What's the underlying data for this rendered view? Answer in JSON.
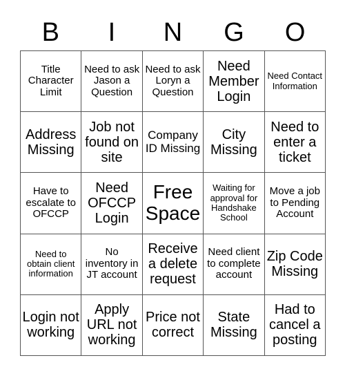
{
  "header": [
    "B",
    "I",
    "N",
    "G",
    "O"
  ],
  "cells": [
    {
      "text": "Title Character Limit",
      "size": "s2"
    },
    {
      "text": "Need to ask Jason a Question",
      "size": "s2"
    },
    {
      "text": "Need to ask Loryn a Question",
      "size": "s2"
    },
    {
      "text": "Need Member Login",
      "size": "s4"
    },
    {
      "text": "Need Contact Information",
      "size": "s1"
    },
    {
      "text": "Address Missing",
      "size": "s4"
    },
    {
      "text": "Job not found on site",
      "size": "s4"
    },
    {
      "text": "Company ID Missing",
      "size": "s3"
    },
    {
      "text": "City Missing",
      "size": "s4"
    },
    {
      "text": "Need to enter a ticket",
      "size": "s4"
    },
    {
      "text": "Have to escalate to OFCCP",
      "size": "s2"
    },
    {
      "text": "Need OFCCP Login",
      "size": "s4"
    },
    {
      "text": "Free Space",
      "size": "s5"
    },
    {
      "text": "Waiting for approval for Handshake School",
      "size": "s1"
    },
    {
      "text": "Move a job to Pending Account",
      "size": "s2"
    },
    {
      "text": "Need to obtain client information",
      "size": "s1"
    },
    {
      "text": "No inventory in JT account",
      "size": "s2"
    },
    {
      "text": "Receive a delete request",
      "size": "s4"
    },
    {
      "text": "Need client to complete account",
      "size": "s2"
    },
    {
      "text": "Zip Code Missing",
      "size": "s4"
    },
    {
      "text": "Login not working",
      "size": "s4"
    },
    {
      "text": "Apply URL not working",
      "size": "s4"
    },
    {
      "text": "Price not correct",
      "size": "s4"
    },
    {
      "text": "State Missing",
      "size": "s4"
    },
    {
      "text": "Had to cancel a posting",
      "size": "s4"
    }
  ]
}
